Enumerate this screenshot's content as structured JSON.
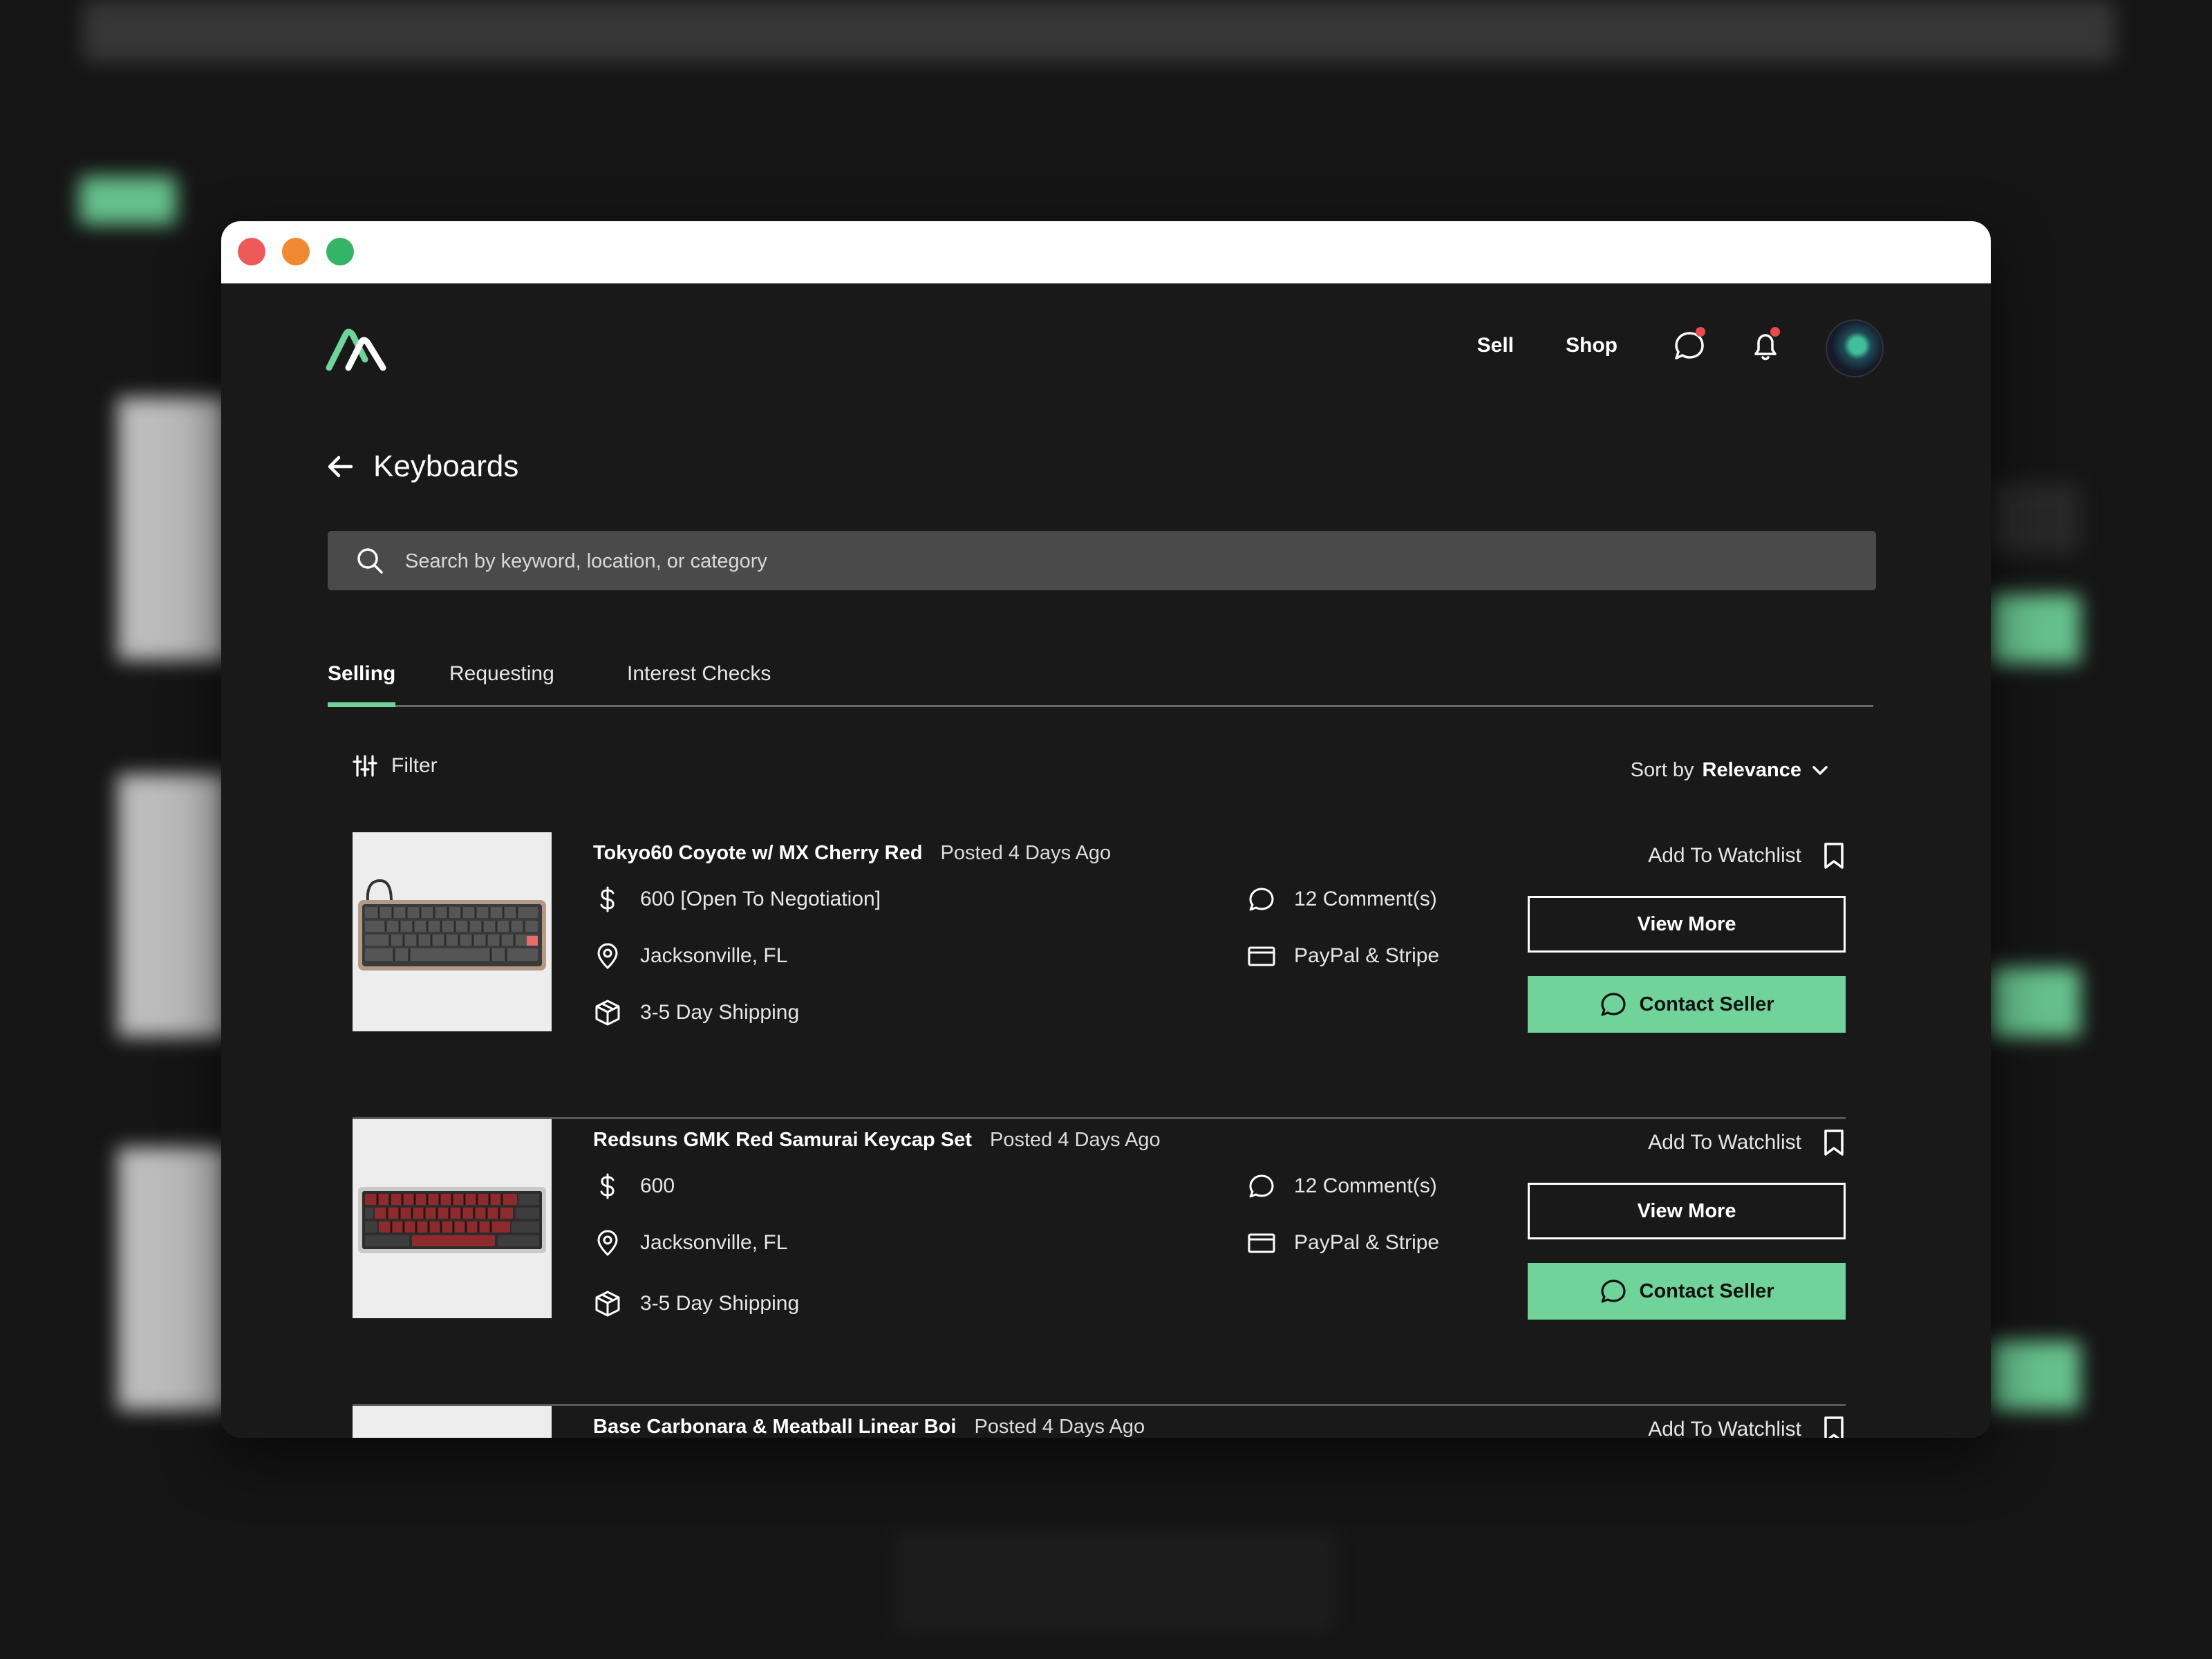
{
  "nav": {
    "sell": "Sell",
    "shop": "Shop"
  },
  "page": {
    "title": "Keyboards"
  },
  "search": {
    "placeholder": "Search by keyword, location, or category"
  },
  "tabs": [
    {
      "label": "Selling",
      "active": true
    },
    {
      "label": "Requesting",
      "active": false
    },
    {
      "label": "Interest Checks",
      "active": false
    }
  ],
  "filter": {
    "label": "Filter"
  },
  "sort": {
    "prefix": "Sort by",
    "value": "Relevance"
  },
  "listings": [
    {
      "title": "Tokyo60 Coyote w/ MX Cherry Red",
      "posted": "Posted 4 Days Ago",
      "price": "600 [Open To Negotiation]",
      "comments": "12 Comment(s)",
      "location": "Jacksonville, FL",
      "payment": "PayPal & Stripe",
      "shipping": "3-5 Day Shipping",
      "watchlist": "Add To Watchlist",
      "view_more": "View More",
      "contact": "Contact Seller"
    },
    {
      "title": "Redsuns GMK Red Samurai Keycap Set",
      "posted": "Posted 4 Days Ago",
      "price": "600",
      "comments": "12 Comment(s)",
      "location": "Jacksonville, FL",
      "payment": "PayPal & Stripe",
      "shipping": "3-5 Day Shipping",
      "watchlist": "Add To Watchlist",
      "view_more": "View More",
      "contact": "Contact Seller"
    },
    {
      "title": "Base Carbonara & Meatball Linear Boi",
      "posted": "Posted 4 Days Ago",
      "watchlist": "Add To Watchlist"
    }
  ],
  "colors": {
    "accent": "#6fd39a",
    "background": "#191919",
    "notification": "#e84b4b"
  }
}
